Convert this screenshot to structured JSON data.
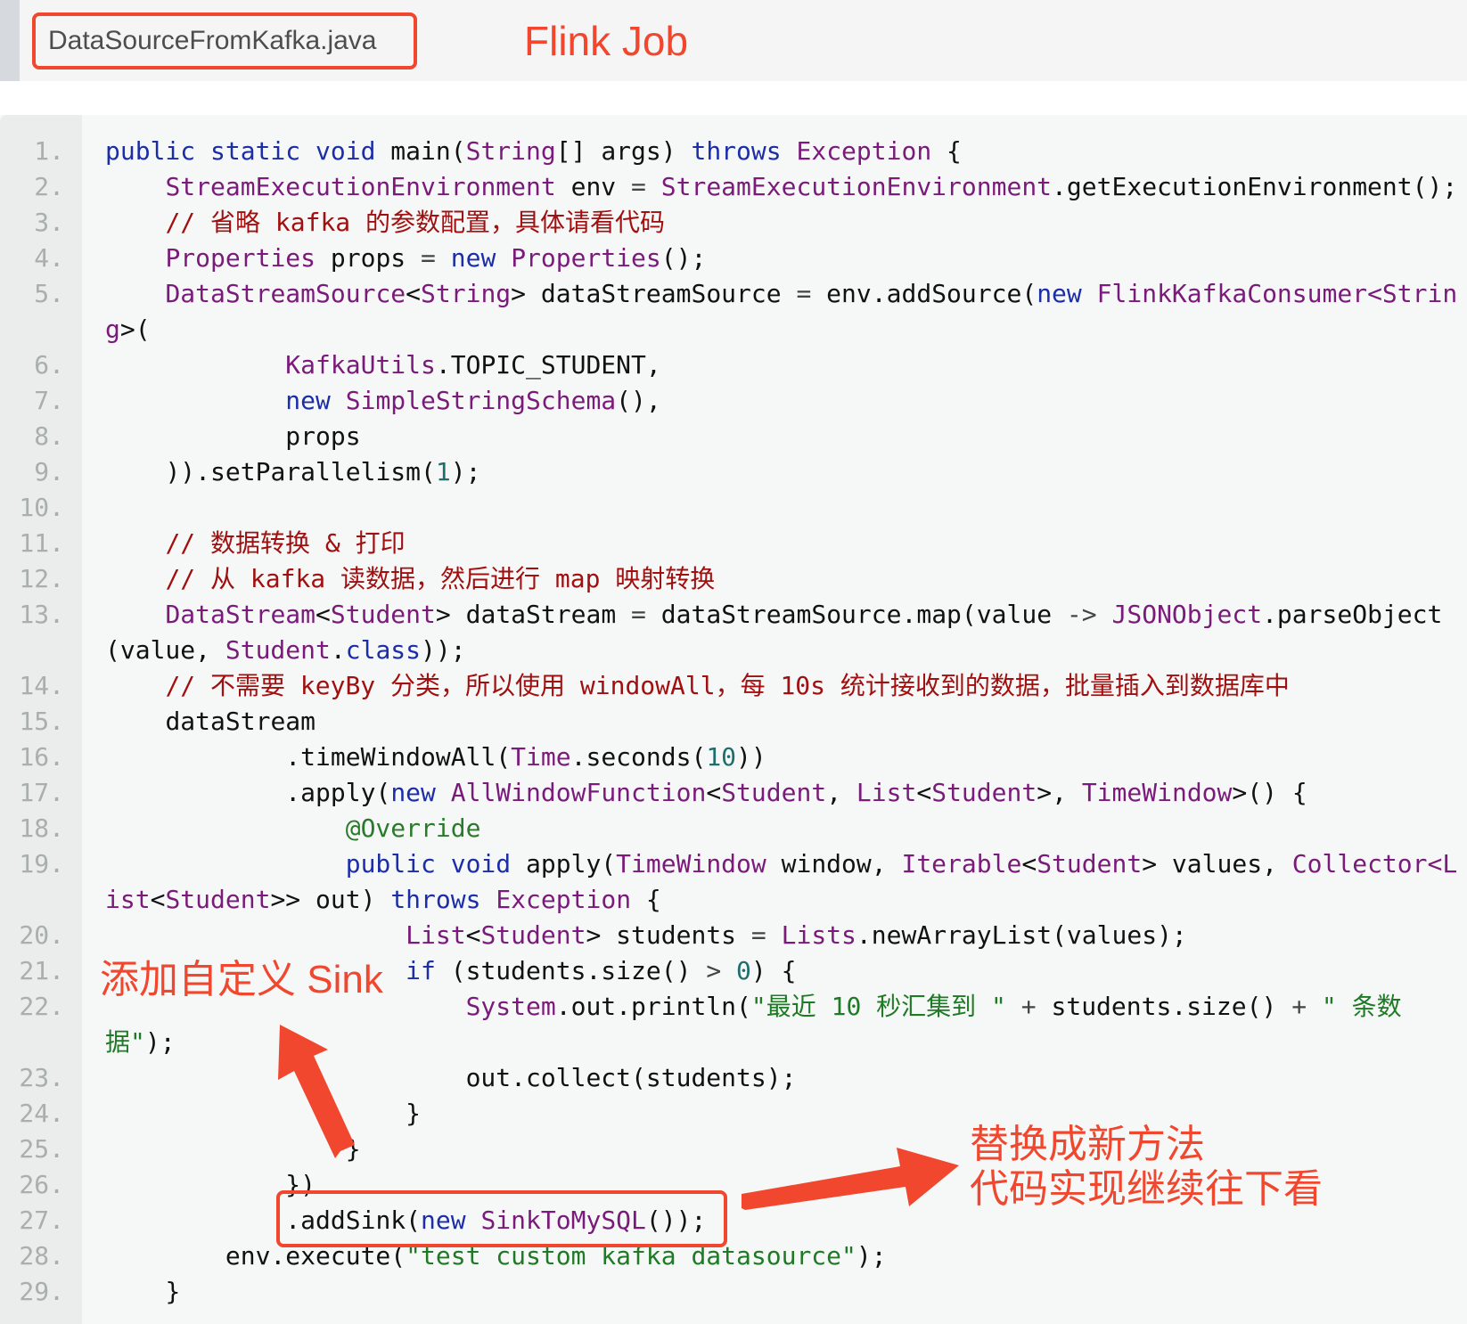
{
  "header": {
    "file_tab": "DataSourceFromKafka.java",
    "title": "Flink Job"
  },
  "annotations": {
    "left": "添加自定义 Sink",
    "right_line1": "替换成新方法",
    "right_line2": "代码实现继续往下看"
  },
  "colors": {
    "accent": "#f0472e",
    "keyword": "#1c2da8",
    "type": "#7a1a7a",
    "comment": "#a01010",
    "string": "#1f7a25"
  },
  "lines": [
    {
      "num": "1.",
      "indent": 0,
      "tokens": [
        [
          "kw",
          "public static void "
        ],
        [
          "",
          "main("
        ],
        [
          "ty",
          "String"
        ],
        [
          "",
          "[] args) "
        ],
        [
          "kw",
          "throws "
        ],
        [
          "ty",
          "Exception"
        ],
        [
          "",
          " {"
        ]
      ]
    },
    {
      "num": "2.",
      "indent": 4,
      "tokens": [
        [
          "ty",
          "StreamExecutionEnvironment"
        ],
        [
          "",
          " env "
        ],
        [
          "op",
          "="
        ],
        [
          "",
          ""
        ],
        [
          "ty",
          " StreamExecutionEnvironment"
        ],
        [
          "",
          ".getExecutionEnvironment();"
        ]
      ]
    },
    {
      "num": "3.",
      "indent": 4,
      "tokens": [
        [
          "cm",
          "// 省略 kafka 的参数配置，具体请看代码"
        ]
      ]
    },
    {
      "num": "4.",
      "indent": 4,
      "tokens": [
        [
          "ty",
          "Properties"
        ],
        [
          "",
          " props "
        ],
        [
          "op",
          "="
        ],
        [
          "kw",
          " new "
        ],
        [
          "ty",
          "Properties"
        ],
        [
          "",
          "();"
        ]
      ]
    },
    {
      "num": "5.",
      "indent": 4,
      "tokens": [
        [
          "ty",
          "DataStreamSource"
        ],
        [
          "",
          "<"
        ],
        [
          "ty",
          "String"
        ],
        [
          "",
          "> dataStreamSource "
        ],
        [
          "op",
          "="
        ],
        [
          "",
          " env.addSource("
        ],
        [
          "kw",
          "new "
        ],
        [
          "ty",
          "FlinkKafkaConsumer<Strin"
        ]
      ]
    },
    {
      "num": "",
      "indent": 0,
      "tokens": [
        [
          "ty",
          "g"
        ],
        [
          "",
          "&gt;("
        ]
      ]
    },
    {
      "num": "6.",
      "indent": 12,
      "tokens": [
        [
          "ty",
          "KafkaUtils"
        ],
        [
          "",
          ".TOPIC_STUDENT,"
        ]
      ]
    },
    {
      "num": "7.",
      "indent": 12,
      "tokens": [
        [
          "kw",
          "new "
        ],
        [
          "ty",
          "SimpleStringSchema"
        ],
        [
          "",
          "(),"
        ]
      ]
    },
    {
      "num": "8.",
      "indent": 12,
      "tokens": [
        [
          "",
          "props"
        ]
      ]
    },
    {
      "num": "9.",
      "indent": 4,
      "tokens": [
        [
          "",
          "))."
        ],
        [
          "",
          "setParallelism("
        ],
        [
          "nm",
          "1"
        ],
        [
          "",
          ");"
        ]
      ]
    },
    {
      "num": "10.",
      "indent": 0,
      "tokens": []
    },
    {
      "num": "11.",
      "indent": 4,
      "tokens": [
        [
          "cm",
          "// 数据转换 & 打印"
        ]
      ]
    },
    {
      "num": "12.",
      "indent": 4,
      "tokens": [
        [
          "cm",
          "// 从 kafka 读数据，然后进行 map 映射转换"
        ]
      ]
    },
    {
      "num": "13.",
      "indent": 4,
      "tokens": [
        [
          "ty",
          "DataStream"
        ],
        [
          "",
          "<"
        ],
        [
          "ty",
          "Student"
        ],
        [
          "",
          "> dataStream "
        ],
        [
          "op",
          "="
        ],
        [
          "",
          " dataStreamSource.map(value "
        ],
        [
          "op",
          "->"
        ],
        [
          "ty",
          " JSONObject"
        ],
        [
          "",
          ".parseObject"
        ]
      ]
    },
    {
      "num": "",
      "indent": 0,
      "tokens": [
        [
          "",
          "(value, "
        ],
        [
          "ty",
          "Student"
        ],
        [
          "",
          "."
        ],
        [
          "kw",
          "class"
        ],
        [
          "",
          "));"
        ]
      ]
    },
    {
      "num": "14.",
      "indent": 4,
      "tokens": [
        [
          "cm",
          "// 不需要 keyBy 分类，所以使用 windowAll，每 10s 统计接收到的数据，批量插入到数据库中"
        ]
      ]
    },
    {
      "num": "15.",
      "indent": 4,
      "tokens": [
        [
          "",
          "dataStream"
        ]
      ]
    },
    {
      "num": "16.",
      "indent": 12,
      "tokens": [
        [
          "",
          ".timeWindowAll("
        ],
        [
          "ty",
          "Time"
        ],
        [
          "",
          ".seconds("
        ],
        [
          "nm",
          "10"
        ],
        [
          "",
          "))"
        ]
      ]
    },
    {
      "num": "17.",
      "indent": 12,
      "tokens": [
        [
          "",
          ".apply("
        ],
        [
          "kw",
          "new "
        ],
        [
          "ty",
          "AllWindowFunction"
        ],
        [
          "",
          "<"
        ],
        [
          "ty",
          "Student"
        ],
        [
          "",
          ", "
        ],
        [
          "ty",
          "List"
        ],
        [
          "",
          "<"
        ],
        [
          "ty",
          "Student"
        ],
        [
          "",
          ">, "
        ],
        [
          "ty",
          "TimeWindow"
        ],
        [
          "",
          ">() {"
        ]
      ]
    },
    {
      "num": "18.",
      "indent": 16,
      "tokens": [
        [
          "an",
          "@Override"
        ]
      ]
    },
    {
      "num": "19.",
      "indent": 16,
      "tokens": [
        [
          "kw",
          "public void "
        ],
        [
          "",
          "apply("
        ],
        [
          "ty",
          "TimeWindow"
        ],
        [
          "",
          " window, "
        ],
        [
          "ty",
          "Iterable"
        ],
        [
          "",
          "<"
        ],
        [
          "ty",
          "Student"
        ],
        [
          "",
          "> values, "
        ],
        [
          "ty",
          "Collector<L"
        ]
      ]
    },
    {
      "num": "",
      "indent": 0,
      "tokens": [
        [
          "ty",
          "ist"
        ],
        [
          "",
          "<"
        ],
        [
          "ty",
          "Student"
        ],
        [
          "",
          ">> out) "
        ],
        [
          "kw",
          "throws "
        ],
        [
          "ty",
          "Exception"
        ],
        [
          "",
          " {"
        ]
      ]
    },
    {
      "num": "20.",
      "indent": 20,
      "tokens": [
        [
          "ty",
          "List"
        ],
        [
          "",
          "<"
        ],
        [
          "ty",
          "Student"
        ],
        [
          "",
          "> students "
        ],
        [
          "op",
          "="
        ],
        [
          "ty",
          " Lists"
        ],
        [
          "",
          ".newArrayList(values);"
        ]
      ]
    },
    {
      "num": "21.",
      "indent": 20,
      "tokens": [
        [
          "kw",
          "if"
        ],
        [
          "",
          " (students.size() "
        ],
        [
          "op",
          "&gt;"
        ],
        [
          "",
          " "
        ],
        [
          "nm",
          "0"
        ],
        [
          "",
          ") {"
        ]
      ]
    },
    {
      "num": "22.",
      "indent": 24,
      "tokens": [
        [
          "ty",
          "System"
        ],
        [
          "",
          ".out.println("
        ],
        [
          "str",
          "\"最近 10 秒汇集到 \""
        ],
        [
          "op",
          " +"
        ],
        [
          "",
          " students.size() "
        ],
        [
          "op",
          "+"
        ],
        [
          "str",
          " \" 条数"
        ]
      ]
    },
    {
      "num": "",
      "indent": 0,
      "tokens": [
        [
          "str",
          "据\""
        ],
        [
          "",
          ");"
        ]
      ]
    },
    {
      "num": "23.",
      "indent": 24,
      "tokens": [
        [
          "",
          "out.collect(students);"
        ]
      ]
    },
    {
      "num": "24.",
      "indent": 20,
      "tokens": [
        [
          "",
          "}"
        ]
      ]
    },
    {
      "num": "25.",
      "indent": 16,
      "tokens": [
        [
          "",
          "}"
        ]
      ]
    },
    {
      "num": "26.",
      "indent": 12,
      "tokens": [
        [
          "",
          "})"
        ]
      ]
    },
    {
      "num": "27.",
      "indent": 12,
      "tokens": [
        [
          "",
          ".addSink("
        ],
        [
          "kw",
          "new "
        ],
        [
          "ty",
          "SinkToMySQL"
        ],
        [
          "",
          "());"
        ]
      ]
    },
    {
      "num": "28.",
      "indent": 8,
      "tokens": [
        [
          "",
          "env.execute("
        ],
        [
          "str",
          "\"test custom kafka datasource\""
        ],
        [
          "",
          ");"
        ]
      ]
    },
    {
      "num": "29.",
      "indent": 4,
      "tokens": [
        [
          "",
          "}"
        ]
      ]
    }
  ]
}
